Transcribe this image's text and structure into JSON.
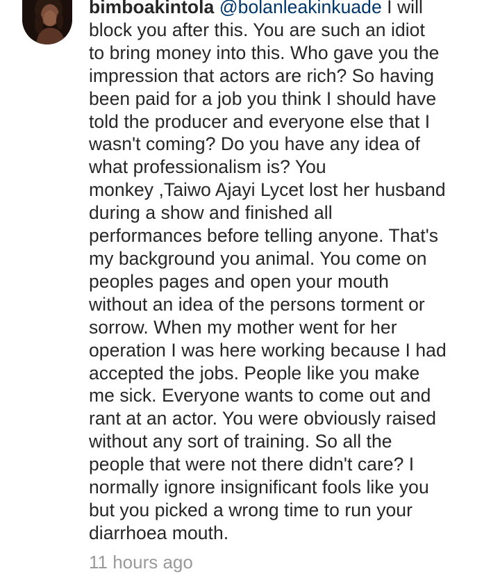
{
  "comment": {
    "username": "bimboakintola",
    "mention": "@bolanleakinkuade",
    "first_line_rest": " I will",
    "lines": [
      "block you after this. You are such an idiot",
      "to bring money into this. Who gave you the",
      "impression that actors are rich? So having",
      "been paid for a job you think I should have",
      "told the producer and everyone else that I",
      "wasn't coming? Do you have any idea of",
      "what professionalism is? You",
      "monkey ,Taiwo Ajayi Lycet lost her husband",
      "during a show and finished all",
      "performances before telling anyone. That's",
      "my background you animal. You come on",
      "peoples pages and open your mouth",
      "without an idea of the persons torment or",
      "sorrow. When my mother went for her",
      "operation I was here working because I had",
      "accepted the jobs. People like you make",
      "me sick. Everyone wants to come out and",
      "rant at an actor. You were obviously raised",
      "without any sort of training. So all the",
      "people that were not there didn't care? I",
      "normally ignore insignificant fools like you",
      "but you picked a wrong time to run your",
      "diarrhoea mouth."
    ],
    "timestamp": "11 hours ago"
  },
  "colors": {
    "text": "#262626",
    "mention": "#003569",
    "timestamp": "#999999"
  }
}
